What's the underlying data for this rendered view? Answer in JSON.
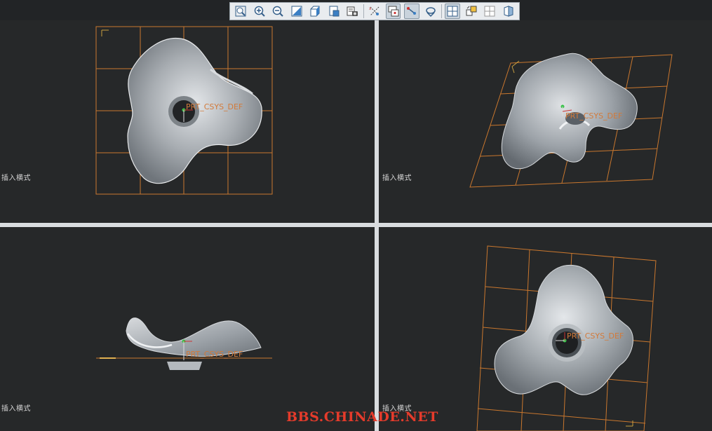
{
  "toolbar": {
    "buttons": [
      {
        "name": "refit-icon",
        "active": false
      },
      {
        "name": "zoom-in-icon",
        "active": false
      },
      {
        "name": "zoom-out-icon",
        "active": false
      },
      {
        "name": "repaint-icon",
        "active": false
      },
      {
        "name": "display-style-icon",
        "active": false
      },
      {
        "name": "saved-orientations-icon",
        "active": false
      },
      {
        "name": "view-manager-icon",
        "active": false
      },
      {
        "name": "datum-display-icon",
        "active": false
      },
      {
        "name": "spin-center-icon",
        "active": true
      },
      {
        "name": "csys-display-icon",
        "active": true
      },
      {
        "name": "annotation-display-icon",
        "active": false
      },
      {
        "name": "multi-viewport-icon",
        "active": true
      },
      {
        "name": "view-layout-icon",
        "active": false
      },
      {
        "name": "single-view-icon",
        "active": false
      },
      {
        "name": "section-view-icon",
        "active": false
      }
    ]
  },
  "viewports": {
    "top_left": {
      "label": "插入横式",
      "csys": "PRT_CSYS_DEF"
    },
    "top_right": {
      "label": "插入横式",
      "csys": "PRT_CSYS_DEF"
    },
    "bottom_left": {
      "label": "插入横式",
      "csys": "PRT_CSYS_DEF"
    },
    "bottom_right": {
      "label": "插入横式",
      "csys": "PRT_CSYS_DEF"
    }
  },
  "watermark": "BBS.CHINADE.NET",
  "colors": {
    "background": "#262829",
    "grid": "#c9772e",
    "surface": "#aeb3b8",
    "csys_text": "#d27a3a",
    "watermark": "#e53b2b"
  }
}
